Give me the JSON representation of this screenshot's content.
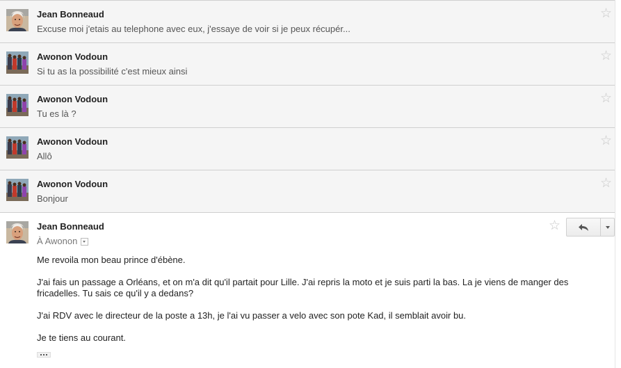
{
  "thread": {
    "collapsed_messages": [
      {
        "sender": "Jean Bonneaud",
        "snippet": "Excuse moi j'etais au telephone avec eux, j'essaye de voir si je peux récupér...",
        "avatar": "jean-portrait"
      },
      {
        "sender": "Awonon Vodoun",
        "snippet": "Si tu as la possibilité c'est mieux ainsi",
        "avatar": "group-photo"
      },
      {
        "sender": "Awonon Vodoun",
        "snippet": "Tu es là ?",
        "avatar": "group-photo"
      },
      {
        "sender": "Awonon Vodoun",
        "snippet": "Allô",
        "avatar": "group-photo"
      },
      {
        "sender": "Awonon Vodoun",
        "snippet": "Bonjour",
        "avatar": "group-photo"
      }
    ],
    "expanded_message": {
      "sender": "Jean Bonneaud",
      "recipient": "À Awonon",
      "avatar": "jean-portrait",
      "paragraphs": [
        "Me revoila mon beau prince d'ébène.",
        "J'ai fais un passage a Orléans, et on m'a dit qu'il partait pour Lille. J'ai repris la moto et je suis parti la bas. La je viens de manger des fricadelles. Tu sais ce qu'il y a dedans?",
        "J'ai RDV avec le directeur de la poste a 13h, je l'ai vu passer a velo avec son pote Kad, il semblait avoir bu.",
        "Je te tiens au courant."
      ]
    },
    "icons": {
      "star": "☆",
      "reply": "reply-arrow-icon",
      "more": "dropdown-caret-icon",
      "trimmed": "ellipsis-icon"
    },
    "colors": {
      "collapsed_bg": "#f5f5f5",
      "star": "#c6c6c6",
      "snippet": "#555555"
    }
  }
}
